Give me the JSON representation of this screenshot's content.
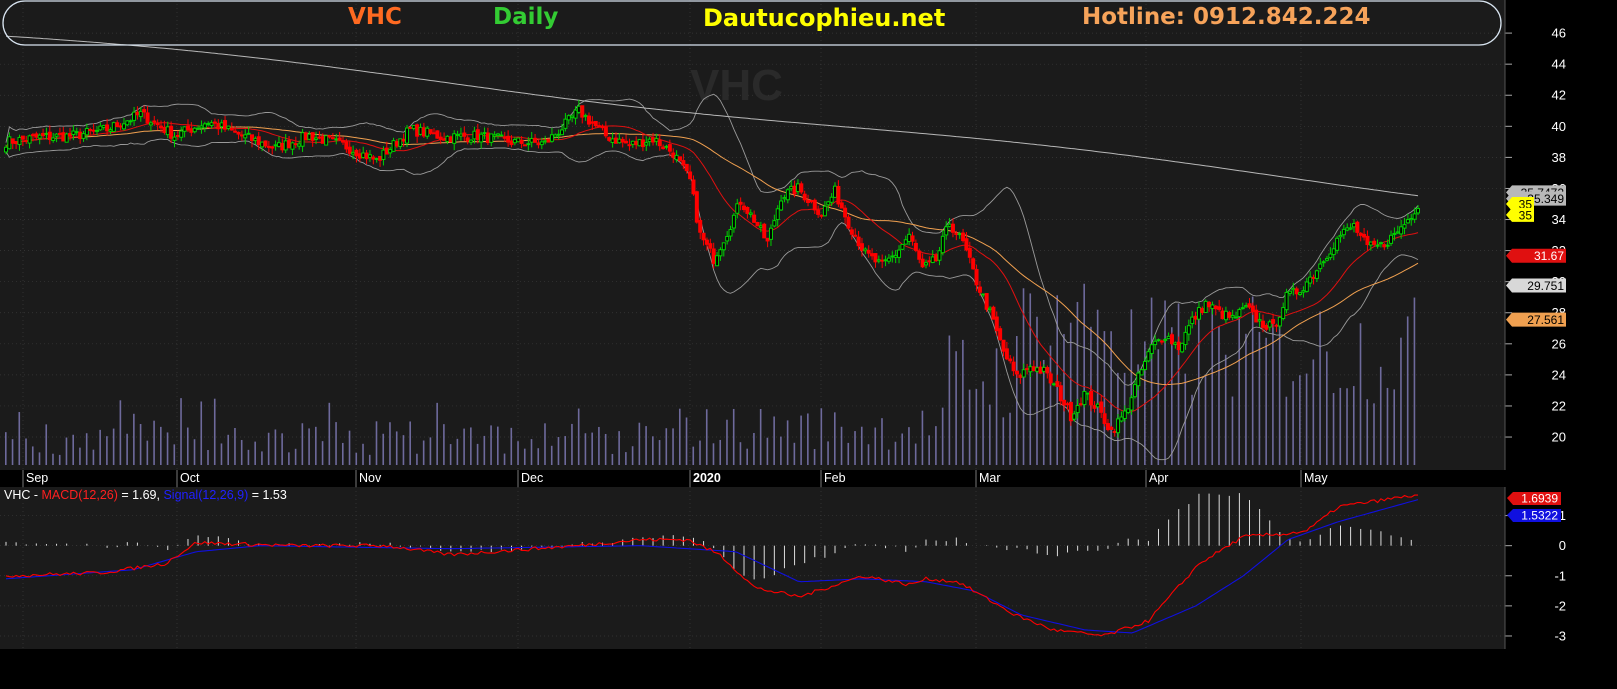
{
  "header": {
    "ticker": "VHC",
    "period": "Daily",
    "site": "Dautucophieu.net",
    "hotline": "Hotline: 0912.842.224",
    "watermark": "VHC"
  },
  "colors": {
    "background": "#000000",
    "panel": "#1b1b1b",
    "grid": "#3a3a3a",
    "up_candle": "#00d000",
    "down_candle": "#ff0000",
    "ticker": "#ff6a21",
    "period": "#33cc33",
    "site": "#ffff00",
    "hotline": "#f6a35a",
    "ma20": "#e01010",
    "ma50": "#f0a050",
    "ma200": "#b8b8b8",
    "bollinger": "#9a9a9a",
    "volume": "#6e6a9c",
    "macd": "#ff0000",
    "signal": "#1010e0"
  },
  "months": [
    "Sep",
    "Oct",
    "Nov",
    "Dec",
    "2020",
    "Feb",
    "Mar",
    "Apr",
    "May"
  ],
  "price_badges": [
    {
      "label": "35.7472",
      "value": 35.7472,
      "bg": "#b8b8b8",
      "fg": "#000000"
    },
    {
      "label": "35.349",
      "value": 35.349,
      "bg": "#b8b8b8",
      "fg": "#000000"
    },
    {
      "label": "35",
      "value": 35,
      "bg": "#ffff00",
      "fg": "#000000"
    },
    {
      "label": "35",
      "value": 34.3,
      "bg": "#ffff00",
      "fg": "#000000"
    },
    {
      "label": "31.67",
      "value": 31.67,
      "bg": "#e01010",
      "fg": "#ffffff"
    },
    {
      "label": "29.751",
      "value": 29.751,
      "bg": "#d8d8d8",
      "fg": "#000000"
    },
    {
      "label": "27.561",
      "value": 27.561,
      "bg": "#f0a050",
      "fg": "#000000"
    }
  ],
  "indicator_panel": {
    "title_prefix": "VHC - ",
    "macd_label": "MACD(12,26)",
    "macd_value_text": " = 1.69, ",
    "signal_label": "Signal(12,26,9)",
    "signal_value_text": " = 1.53",
    "macd_badge": "1.6939",
    "signal_badge": "1.5322"
  },
  "chart_data": [
    {
      "type": "candlestick",
      "title": "VHC Daily",
      "y_ticks": [
        20,
        22,
        24,
        26,
        28,
        30,
        32,
        34,
        36,
        38,
        40,
        42,
        44,
        46
      ],
      "ylim": [
        18.2,
        47.1
      ],
      "grid": true,
      "month_labels": [
        "Sep",
        "Oct",
        "Nov",
        "Dec",
        "2020",
        "Feb",
        "Mar",
        "Apr",
        "May"
      ],
      "keypoints": [
        [
          0,
          39.0
        ],
        [
          10,
          39.3
        ],
        [
          20,
          39.4
        ],
        [
          30,
          39.8
        ],
        [
          40,
          40.8
        ],
        [
          50,
          39.4
        ],
        [
          60,
          40.3
        ],
        [
          70,
          39.4
        ],
        [
          80,
          38.6
        ],
        [
          90,
          39.4
        ],
        [
          100,
          38.8
        ],
        [
          110,
          37.8
        ],
        [
          120,
          39.8
        ],
        [
          130,
          39.3
        ],
        [
          140,
          39.4
        ],
        [
          150,
          39.0
        ],
        [
          160,
          38.9
        ],
        [
          165,
          39.9
        ],
        [
          170,
          41.0
        ],
        [
          178,
          39.4
        ],
        [
          185,
          38.8
        ],
        [
          192,
          39.2
        ],
        [
          198,
          38.3
        ],
        [
          203,
          36.5
        ],
        [
          206,
          33.0
        ],
        [
          210,
          31.5
        ],
        [
          214,
          33.2
        ],
        [
          218,
          35.2
        ],
        [
          222,
          34.0
        ],
        [
          226,
          32.5
        ],
        [
          230,
          35.5
        ],
        [
          235,
          36.0
        ],
        [
          238,
          35.3
        ],
        [
          242,
          34.4
        ],
        [
          246,
          35.8
        ],
        [
          250,
          33.8
        ],
        [
          255,
          31.8
        ],
        [
          260,
          31.0
        ],
        [
          264,
          31.8
        ],
        [
          268,
          33.0
        ],
        [
          272,
          30.8
        ],
        [
          276,
          31.4
        ],
        [
          280,
          33.8
        ],
        [
          284,
          32.5
        ],
        [
          288,
          30.0
        ],
        [
          292,
          28.0
        ],
        [
          296,
          25.5
        ],
        [
          300,
          23.8
        ],
        [
          304,
          24.6
        ],
        [
          308,
          24.2
        ],
        [
          312,
          23.0
        ],
        [
          316,
          21.4
        ],
        [
          320,
          22.8
        ],
        [
          324,
          21.8
        ],
        [
          328,
          20.4
        ],
        [
          332,
          21.5
        ],
        [
          336,
          23.8
        ],
        [
          340,
          25.8
        ],
        [
          344,
          26.6
        ],
        [
          348,
          25.8
        ],
        [
          352,
          27.5
        ],
        [
          356,
          28.6
        ],
        [
          360,
          28.0
        ],
        [
          364,
          27.6
        ],
        [
          368,
          28.3
        ],
        [
          372,
          27.4
        ],
        [
          376,
          27.0
        ],
        [
          380,
          29.0
        ],
        [
          384,
          29.5
        ],
        [
          388,
          30.5
        ],
        [
          392,
          31.8
        ],
        [
          396,
          33.0
        ],
        [
          400,
          33.6
        ],
        [
          404,
          32.2
        ],
        [
          408,
          32.3
        ],
        [
          412,
          33.0
        ],
        [
          416,
          34.0
        ],
        [
          419,
          35.0
        ]
      ]
    },
    {
      "type": "line",
      "title": "MACD(12,26) / Signal(12,26,9)",
      "y_ticks": [
        -3,
        -2,
        -1,
        0,
        1
      ],
      "ylim": [
        -3.3,
        1.75
      ],
      "series": [
        {
          "name": "MACD(12,26)",
          "last": 1.69,
          "keypoints": [
            [
              0,
              -1.0
            ],
            [
              30,
              -0.9
            ],
            [
              50,
              -0.6
            ],
            [
              60,
              0.1
            ],
            [
              90,
              0.0
            ],
            [
              120,
              0.0
            ],
            [
              140,
              -0.3
            ],
            [
              180,
              0.0
            ],
            [
              200,
              0.2
            ],
            [
              215,
              0.2
            ],
            [
              225,
              -0.3
            ],
            [
              236,
              -1.4
            ],
            [
              250,
              -1.7
            ],
            [
              270,
              -1.0
            ],
            [
              285,
              -1.3
            ],
            [
              290,
              -1.1
            ],
            [
              300,
              -1.2
            ],
            [
              318,
              -2.3
            ],
            [
              330,
              -2.8
            ],
            [
              346,
              -3.0
            ],
            [
              360,
              -2.5
            ],
            [
              376,
              -0.6
            ],
            [
              390,
              0.3
            ],
            [
              404,
              0.4
            ],
            [
              410,
              0.5
            ],
            [
              420,
              1.3
            ],
            [
              445,
              1.69
            ]
          ]
        },
        {
          "name": "Signal(12,26,9)",
          "last": 1.53,
          "keypoints": [
            [
              0,
              -1.1
            ],
            [
              40,
              -0.8
            ],
            [
              60,
              -0.2
            ],
            [
              80,
              0.0
            ],
            [
              140,
              -0.1
            ],
            [
              200,
              0.0
            ],
            [
              230,
              -0.2
            ],
            [
              250,
              -1.2
            ],
            [
              270,
              -1.1
            ],
            [
              290,
              -1.2
            ],
            [
              305,
              -1.5
            ],
            [
              320,
              -2.3
            ],
            [
              340,
              -2.8
            ],
            [
              355,
              -2.9
            ],
            [
              375,
              -2.0
            ],
            [
              390,
              -1.0
            ],
            [
              404,
              0.2
            ],
            [
              420,
              0.8
            ],
            [
              445,
              1.53
            ]
          ]
        }
      ]
    }
  ]
}
